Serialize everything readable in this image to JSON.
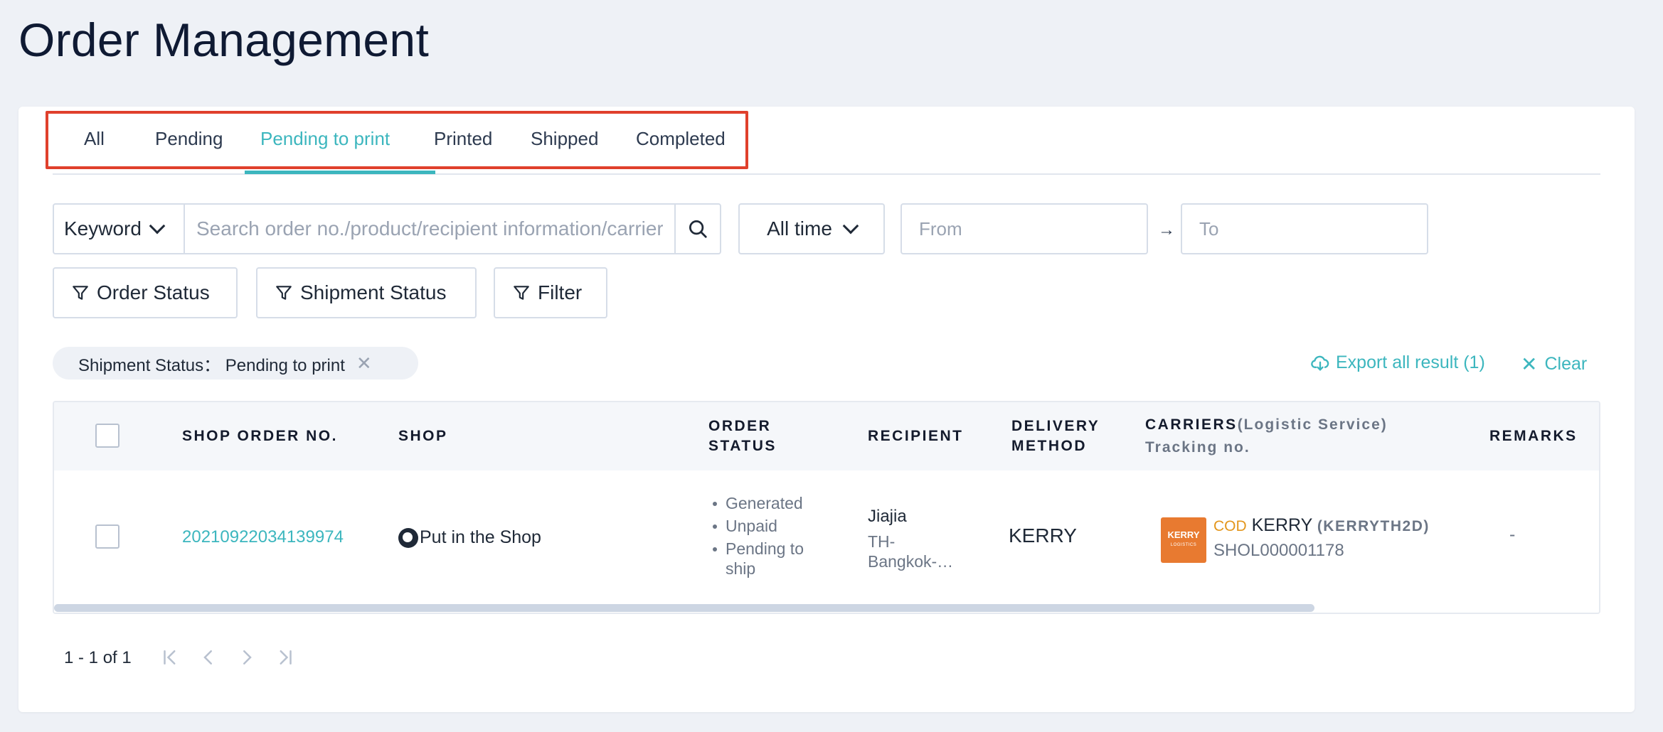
{
  "page": {
    "title": "Order Management"
  },
  "tabs": [
    {
      "label": "All"
    },
    {
      "label": "Pending"
    },
    {
      "label": "Pending to print"
    },
    {
      "label": "Printed"
    },
    {
      "label": "Shipped"
    },
    {
      "label": "Completed"
    }
  ],
  "active_tab": "Pending to print",
  "search": {
    "field_select": "Keyword",
    "placeholder": "Search order no./product/recipient information/carrier",
    "value": ""
  },
  "time_filter": {
    "selected": "All time"
  },
  "date_range": {
    "from_placeholder": "From",
    "to_placeholder": "To"
  },
  "filters": {
    "order_status": "Order Status",
    "shipment_status": "Shipment Status",
    "filter": "Filter"
  },
  "active_filter_chip": {
    "label": "Shipment Status： Pending to print"
  },
  "actions": {
    "export": "Export all result (1)",
    "clear": "Clear"
  },
  "table": {
    "headers": {
      "shop_order_no": "SHOP ORDER NO.",
      "shop": "SHOP",
      "order_status_1": "ORDER",
      "order_status_2": "STATUS",
      "recipient": "RECIPIENT",
      "delivery_1": "DELIVERY",
      "delivery_2": "METHOD",
      "carriers": "CARRIERS",
      "carriers_sub": "(Logistic Service)",
      "tracking": "Tracking no.",
      "remarks": "REMARKS"
    },
    "rows": [
      {
        "shop_order_no": "20210922034139974",
        "shop": "Put in the Shop",
        "order_status": [
          "Generated",
          "Unpaid",
          "Pending to",
          "ship"
        ],
        "recipient_name": "Jiajia",
        "recipient_addr_1": "TH-",
        "recipient_addr_2": "Bangkok-…",
        "delivery_method": "KERRY",
        "carrier_logo_text": "KERRY",
        "carrier_logo_sub": "LOGISTICS",
        "cod_label": "COD",
        "carrier_name": "KERRY",
        "logistic_service": "(KERRYTH2D)",
        "tracking_no": "SHOL000001178",
        "remarks": "-"
      }
    ]
  },
  "pagination": {
    "summary": "1 - 1 of 1"
  },
  "colors": {
    "accent": "#3cb6be",
    "highlight_box": "#e0402c",
    "kerry_orange": "#e87a30",
    "cod": "#e3961c"
  },
  "icons": [
    "chevron-down-icon",
    "search-icon",
    "arrow-right-icon",
    "filter-icon",
    "close-icon",
    "cloud-download-icon",
    "shop-avatar-icon",
    "first-page-icon",
    "prev-page-icon",
    "next-page-icon",
    "last-page-icon"
  ]
}
